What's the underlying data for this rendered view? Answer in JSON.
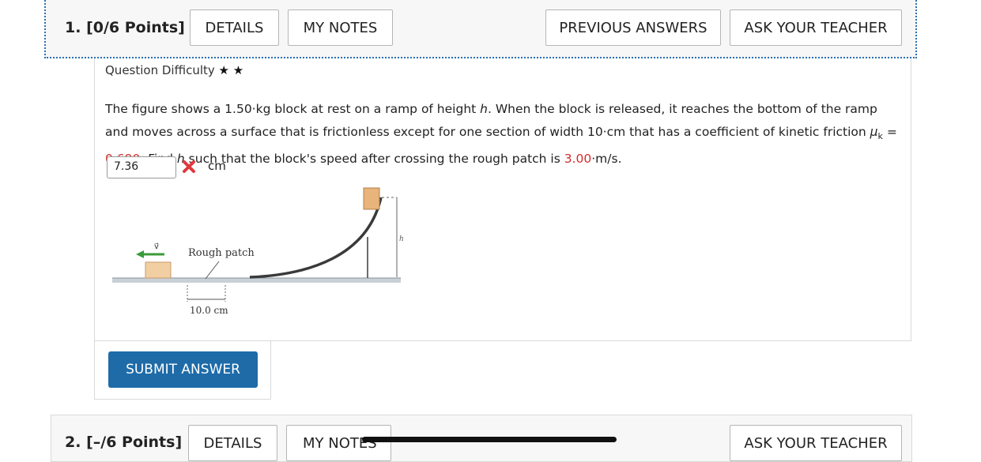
{
  "question1": {
    "number_label": "1.",
    "points_label": "[0/6 Points]",
    "buttons": {
      "details": "DETAILS",
      "my_notes": "MY NOTES",
      "previous_answers": "PREVIOUS ANSWERS",
      "ask_teacher": "ASK YOUR TEACHER"
    },
    "difficulty_label": "Question Difficulty",
    "difficulty_stars": "★ ★",
    "problem": {
      "part1": "The figure shows a 1.50·kg block at rest on a ramp of height ",
      "h": "h",
      "part2": ". When the block is released, it reaches the bottom of the ramp and moves across a surface that is frictionless except for one section of width 10·cm that has a coefficient of kinetic friction ",
      "mu": "μ",
      "mu_sub": "k",
      "part3": " = ",
      "mu_value": "0.690",
      "part4": ". Find ",
      "h2": "h",
      "part5": " such that the block's speed after crossing the rough patch is ",
      "speed_value": "3.00",
      "part6": "·m/s."
    },
    "answer": {
      "value": "7.36",
      "unit": "cm",
      "status": "incorrect"
    },
    "figure": {
      "velocity_label": "v⃗",
      "rough_patch_label": "Rough patch",
      "width_label": "10.0 cm",
      "height_label": "h"
    },
    "submit_label": "SUBMIT ANSWER"
  },
  "question2": {
    "number_label": "2.",
    "points_label": "[–/6 Points]",
    "buttons": {
      "details": "DETAILS",
      "my_notes": "MY NOTES",
      "ask_teacher": "ASK YOUR TEACHER"
    }
  },
  "colors": {
    "accent_blue": "#1e6ba8",
    "error_red": "#d62b2b",
    "header_bg": "#f7f7f7"
  }
}
